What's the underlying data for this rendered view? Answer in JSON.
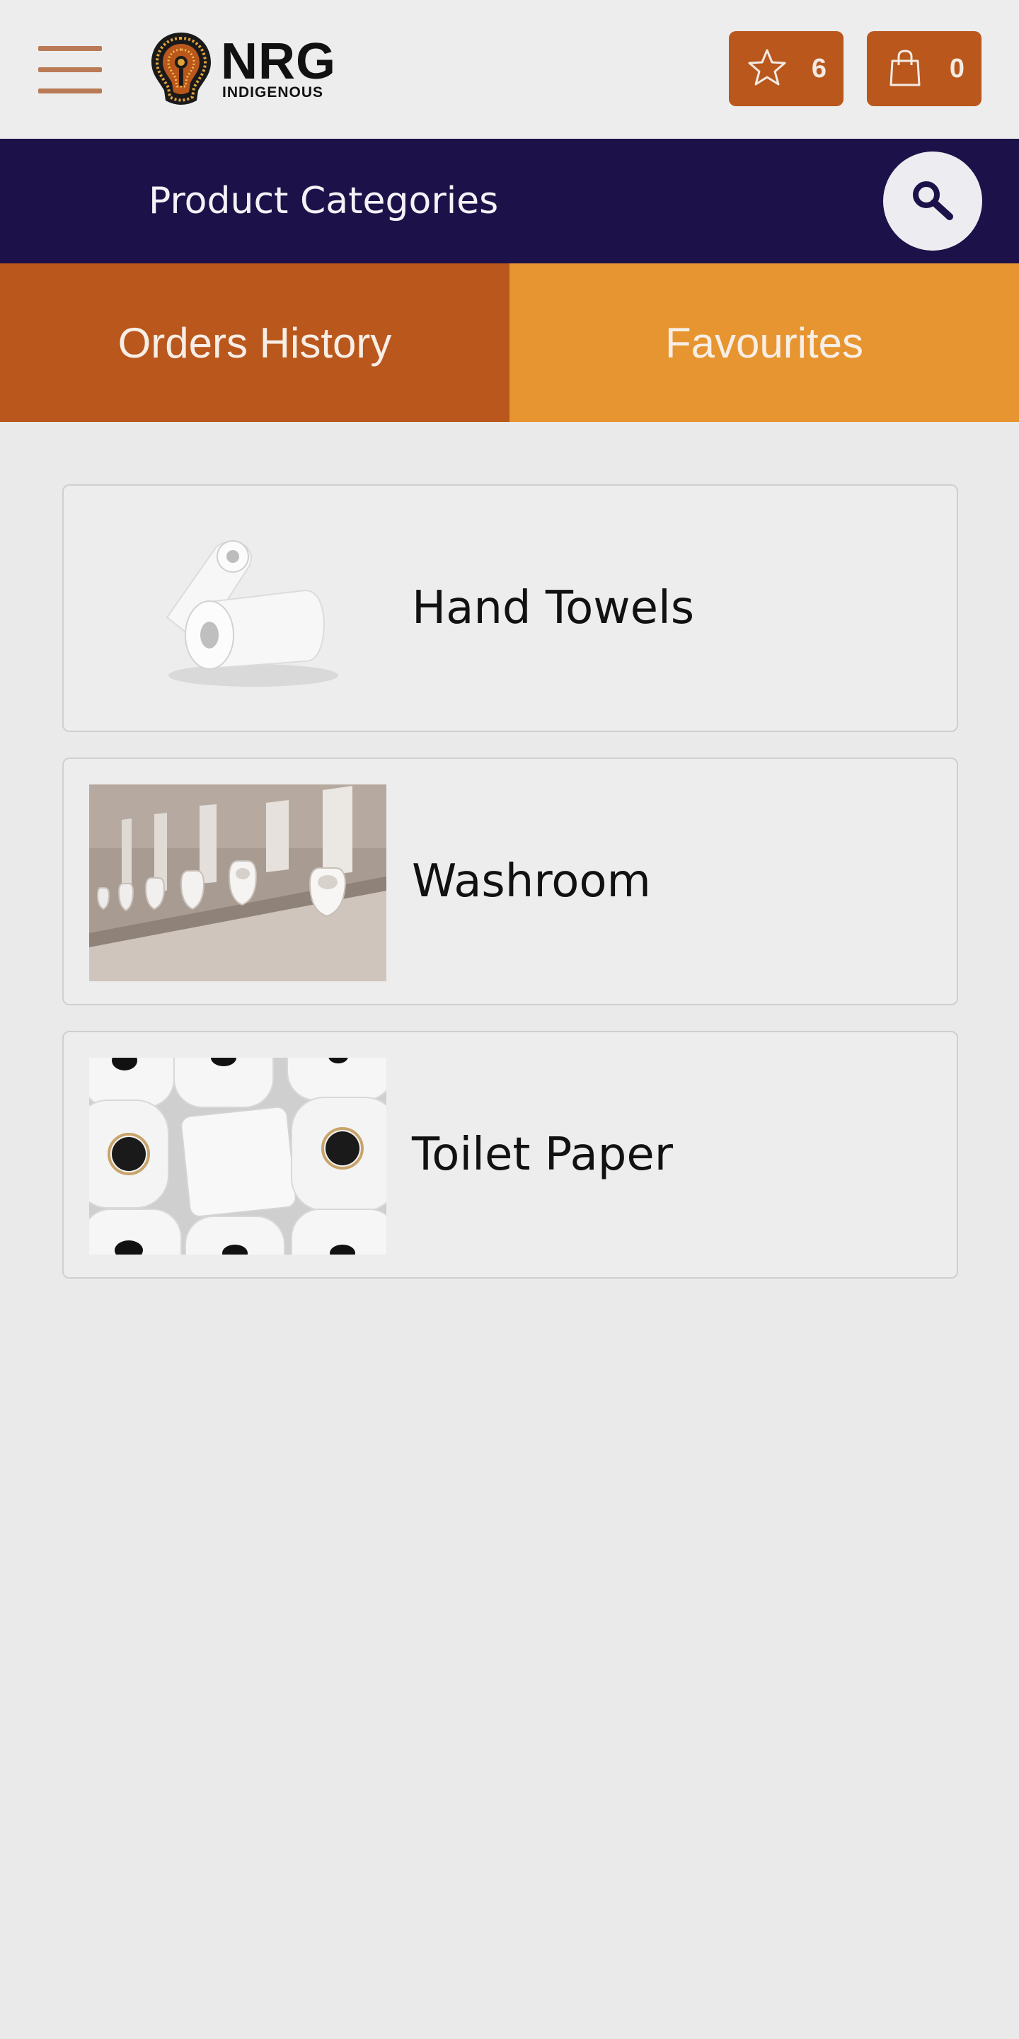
{
  "header": {
    "menu_icon": "hamburger-menu-icon",
    "logo": {
      "title": "NRG",
      "subtitle": "INDIGENOUS",
      "icon": "lightbulb-dotart-logo"
    },
    "favourites": {
      "icon": "star-outline-icon",
      "count": "6"
    },
    "cart": {
      "icon": "shopping-bag-icon",
      "count": "0"
    }
  },
  "category_bar": {
    "title": "Product Categories",
    "search_icon": "magnifier-icon"
  },
  "tabs": [
    {
      "label": "Orders History",
      "color": "#b9571d"
    },
    {
      "label": "Favourites",
      "color": "#e79530"
    }
  ],
  "categories": [
    {
      "label": "Hand Towels",
      "image": "paper-towel-rolls"
    },
    {
      "label": "Washroom",
      "image": "urinals-row"
    },
    {
      "label": "Toilet Paper",
      "image": "toilet-paper-rolls"
    }
  ],
  "colors": {
    "brand_orange": "#b9571d",
    "accent_orange": "#e79530",
    "navy": "#1c1249",
    "background": "#eaeaea"
  }
}
